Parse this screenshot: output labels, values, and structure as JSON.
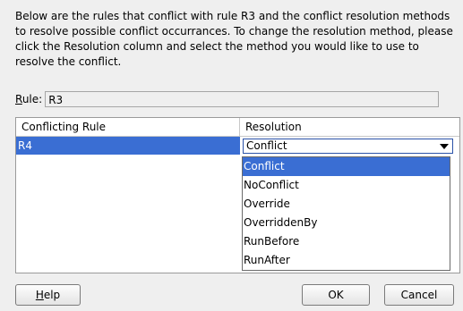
{
  "description": "Below are the rules that conflict with rule R3 and the conflict resolution methods to resolve possible conflict occurrances. To change the resolution method, please click the Resolution column and select the method you would like to use to resolve the conflict.",
  "rule": {
    "label_mnemonic": "R",
    "label_rest": "ule:",
    "value": "R3"
  },
  "table": {
    "columns": [
      "Conflicting Rule",
      "Resolution"
    ],
    "rows": [
      {
        "conflicting_rule": "R4",
        "resolution": "Conflict"
      }
    ]
  },
  "dropdown": {
    "options": [
      "Conflict",
      "NoConflict",
      "Override",
      "OverriddenBy",
      "RunBefore",
      "RunAfter"
    ],
    "selected": "Conflict"
  },
  "buttons": {
    "help_mnemonic": "H",
    "help_rest": "elp",
    "ok": "OK",
    "cancel": "Cancel"
  },
  "colors": {
    "selection": "#3a6ed3",
    "dialog_background": "#efefef"
  }
}
